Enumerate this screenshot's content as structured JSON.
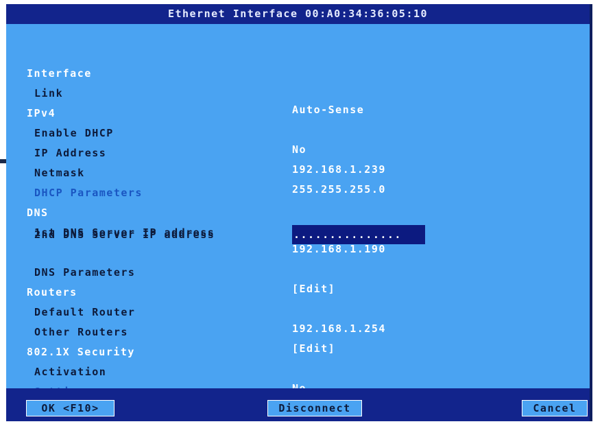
{
  "title": "Ethernet Interface 00:A0:34:36:05:10",
  "rows": [
    {
      "label": "Interface",
      "value": "",
      "kind": "section"
    },
    {
      "label": "Link",
      "value": "Auto-Sense",
      "kind": "item"
    },
    {
      "label": "IPv4",
      "value": "",
      "kind": "section"
    },
    {
      "label": "Enable DHCP",
      "value": "No",
      "kind": "item"
    },
    {
      "label": "IP Address",
      "value": "192.168.1.239",
      "kind": "item"
    },
    {
      "label": "Netmask",
      "value": "255.255.255.0",
      "kind": "item"
    },
    {
      "label": "DHCP Parameters",
      "value": "",
      "kind": "disabled"
    },
    {
      "label": "DNS",
      "value": "",
      "kind": "section"
    },
    {
      "label": "1st DNS Server IP address",
      "value": "192.168.1.190",
      "kind": "item"
    },
    {
      "label": "2nd DNS Server IP address",
      "value": "...............",
      "kind": "item-selected"
    },
    {
      "label": "DNS Parameters",
      "value": "[Edit]",
      "kind": "item"
    },
    {
      "label": "Routers",
      "value": "",
      "kind": "section"
    },
    {
      "label": "Default Router",
      "value": "192.168.1.254",
      "kind": "item"
    },
    {
      "label": "Other Routers",
      "value": "[Edit]",
      "kind": "item"
    },
    {
      "label": "802.1X Security",
      "value": "",
      "kind": "section"
    },
    {
      "label": "Activation",
      "value": "No",
      "kind": "item"
    },
    {
      "label": "Settings",
      "value": "",
      "kind": "disabled"
    }
  ],
  "buttons": {
    "ok": "OK <F10>",
    "disconnect": "Disconnect",
    "cancel": "Cancel"
  },
  "colors": {
    "background": "#4aa3f2",
    "title_bar": "#12248c",
    "selected": "#0c1a80",
    "disabled_text": "#1a56c2"
  }
}
